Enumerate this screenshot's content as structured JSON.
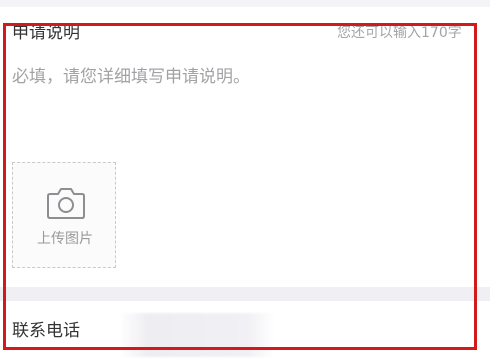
{
  "application": {
    "title": "申请说明",
    "remaining_chars": "您还可以输入170字",
    "description_placeholder": "必填，请您详细填写申请说明。",
    "description_value": ""
  },
  "upload": {
    "icon": "camera-icon",
    "label": "上传图片"
  },
  "contact": {
    "label": "联系电话",
    "value": ""
  },
  "colors": {
    "highlight": "#d21a1a",
    "text_primary": "#333333",
    "text_placeholder": "#a2a2a5",
    "background": "#f4f3f6"
  }
}
